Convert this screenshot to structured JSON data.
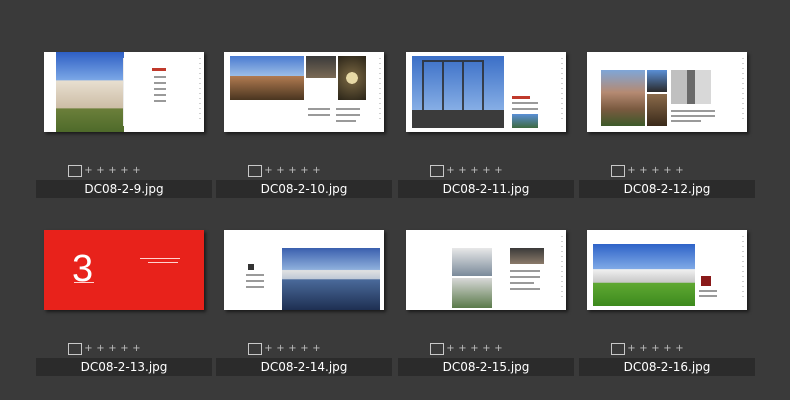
{
  "thumbnails": [
    {
      "filename": "DC08-2-9.jpg"
    },
    {
      "filename": "DC08-2-10.jpg"
    },
    {
      "filename": "DC08-2-11.jpg"
    },
    {
      "filename": "DC08-2-12.jpg"
    },
    {
      "filename": "DC08-2-13.jpg",
      "cover_number": "3"
    },
    {
      "filename": "DC08-2-14.jpg"
    },
    {
      "filename": "DC08-2-15.jpg"
    },
    {
      "filename": "DC08-2-16.jpg"
    }
  ],
  "rating_glyph": "+",
  "colors": {
    "background": "#3a3a3a",
    "label_bar": "#2b2b2b",
    "red_page": "#e8221b"
  }
}
